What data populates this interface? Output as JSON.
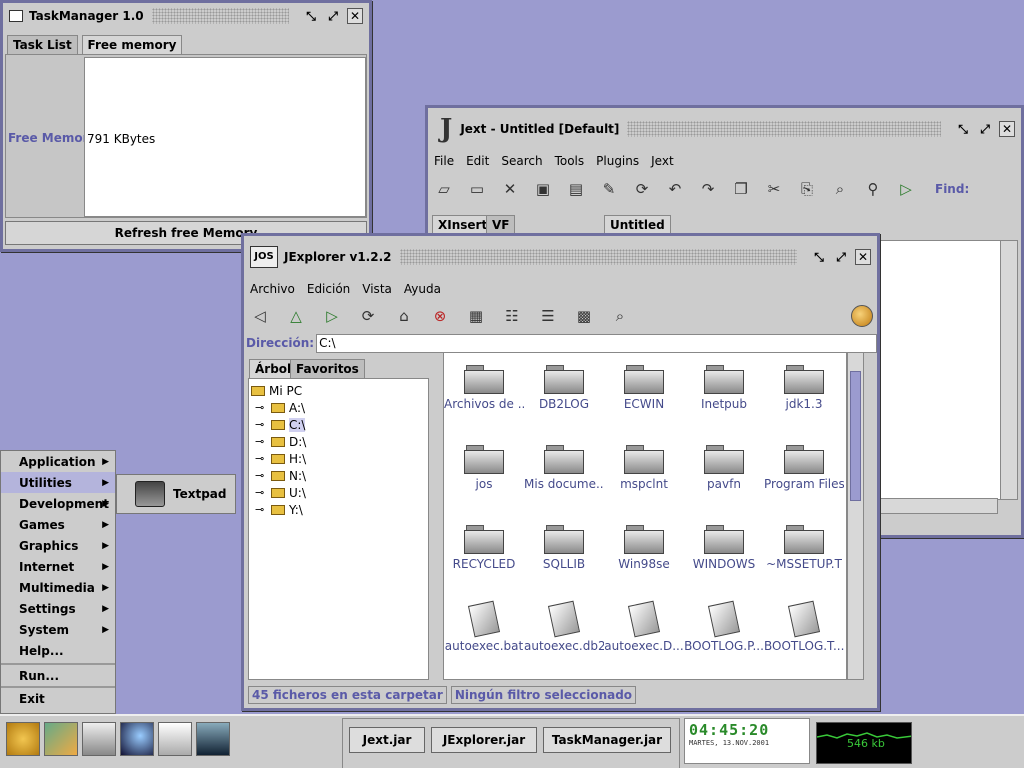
{
  "taskmanager": {
    "title": "TaskManager 1.0",
    "tabs": [
      "Task List",
      "Free memory"
    ],
    "free_label": "Free Memory:",
    "free_value": "791 KBytes",
    "refresh": "Refresh free Memory"
  },
  "jext": {
    "title": "Jext - Untitled [Default]",
    "menu": [
      "File",
      "Edit",
      "Search",
      "Tools",
      "Plugins",
      "Jext"
    ],
    "find_label": "Find:",
    "left_tabs": [
      "XInsert",
      "VF"
    ],
    "doc_tab": "Untitled"
  },
  "jexplorer": {
    "title": "JExplorer v1.2.2",
    "menu": [
      "Archivo",
      "Edición",
      "Vista",
      "Ayuda"
    ],
    "address_label": "Dirección:",
    "address_value": "C:\\",
    "tree_tabs": [
      "Árbol",
      "Favoritos"
    ],
    "tree": [
      "Mi PC",
      "A:\\",
      "C:\\",
      "D:\\",
      "H:\\",
      "N:\\",
      "U:\\",
      "Y:\\"
    ],
    "files": [
      {
        "name": "Archivos de ...",
        "type": "folder"
      },
      {
        "name": "DB2LOG",
        "type": "folder"
      },
      {
        "name": "ECWIN",
        "type": "folder"
      },
      {
        "name": "Inetpub",
        "type": "folder"
      },
      {
        "name": "jdk1.3",
        "type": "folder"
      },
      {
        "name": "jos",
        "type": "folder"
      },
      {
        "name": "Mis docume...",
        "type": "folder"
      },
      {
        "name": "mspclnt",
        "type": "folder"
      },
      {
        "name": "pavfn",
        "type": "folder"
      },
      {
        "name": "Program Files",
        "type": "folder"
      },
      {
        "name": "RECYCLED",
        "type": "folder"
      },
      {
        "name": "SQLLIB",
        "type": "folder"
      },
      {
        "name": "Win98se",
        "type": "folder"
      },
      {
        "name": "WINDOWS",
        "type": "folder"
      },
      {
        "name": "~MSSETUP.T",
        "type": "folder"
      },
      {
        "name": "autoexec.bat",
        "type": "file"
      },
      {
        "name": "autoexec.db2",
        "type": "file"
      },
      {
        "name": "autoexec.D...",
        "type": "file"
      },
      {
        "name": "BOOTLOG.P...",
        "type": "file"
      },
      {
        "name": "BOOTLOG.T...",
        "type": "file"
      }
    ],
    "status_left": "45 ficheros en esta carpetar",
    "status_right": "Ningún filtro seleccionado"
  },
  "start_menu": {
    "items": [
      "Application",
      "Utilities",
      "Development",
      "Games",
      "Graphics",
      "Internet",
      "Multimedia",
      "Settings",
      "System",
      "Help..."
    ],
    "run": "Run...",
    "exit": "Exit",
    "submenu_item": "Textpad"
  },
  "taskbar": {
    "launchers": [
      "jos-icon",
      "paint-icon",
      "jos-folder-icon",
      "earth-icon",
      "jext-icon",
      "orca-icon"
    ],
    "tasks": [
      "Jext.jar",
      "JExplorer.jar",
      "TaskManager.jar"
    ],
    "clock_time": "04:45:20",
    "clock_date": "MARTES, 13.NOV.2001",
    "memory": "546 kb"
  }
}
